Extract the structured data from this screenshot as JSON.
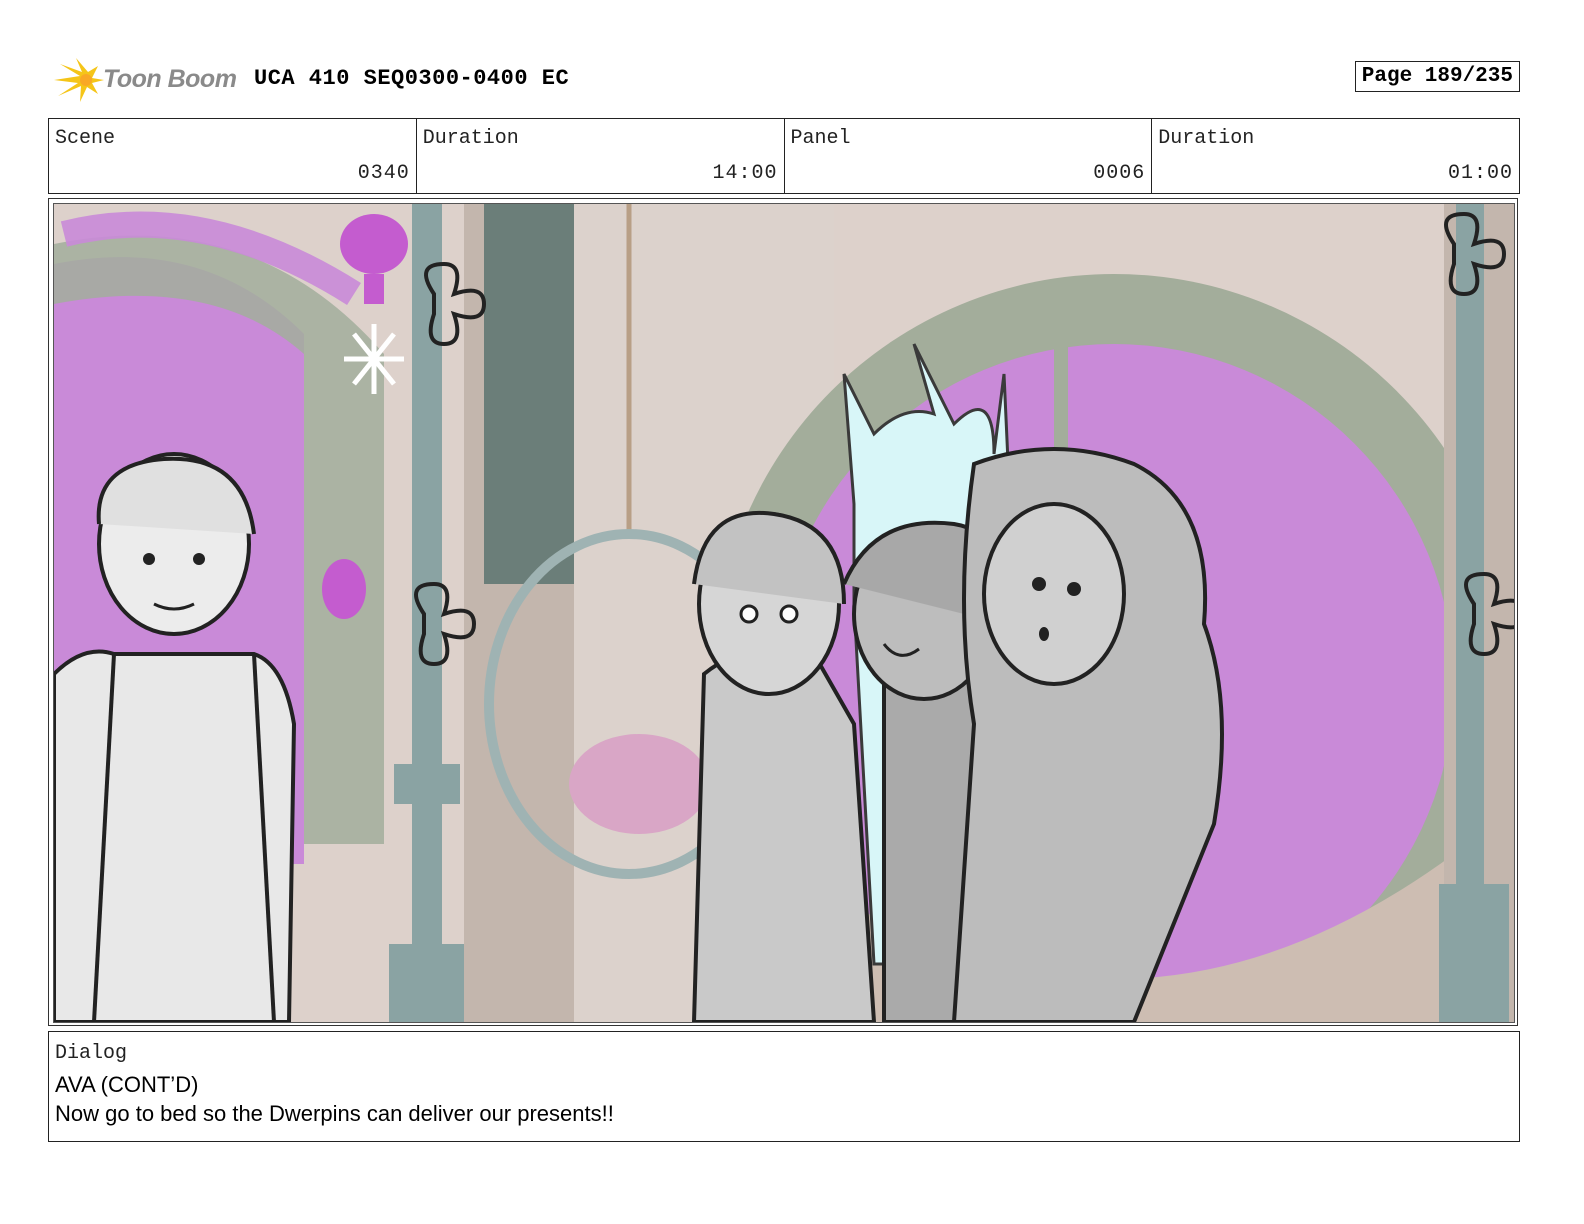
{
  "header": {
    "logo_text": "Toon Boom",
    "title": "UCA 410 SEQ0300-0400 EC",
    "page": "Page 189/235"
  },
  "info": {
    "scene_label": "Scene",
    "scene_value": "0340",
    "scene_duration_label": "Duration",
    "scene_duration_value": "14:00",
    "panel_label": "Panel",
    "panel_value": "0006",
    "panel_duration_label": "Duration",
    "panel_duration_value": "01:00"
  },
  "panel": {
    "image_icon": "storyboard-drawing"
  },
  "dialog": {
    "label": "Dialog",
    "speaker": "AVA (CONT’D)",
    "text": "Now go to bed so the Dwerpins can deliver our presents!!"
  },
  "colors": {
    "logo_accent": "#f5c518",
    "wall_magenta": "#c784d8",
    "arch_green": "#9aa894",
    "column_teal": "#7f9a9a",
    "wall_beige": "#cdbdb2",
    "sketch_gray": "#cfcfcf"
  }
}
